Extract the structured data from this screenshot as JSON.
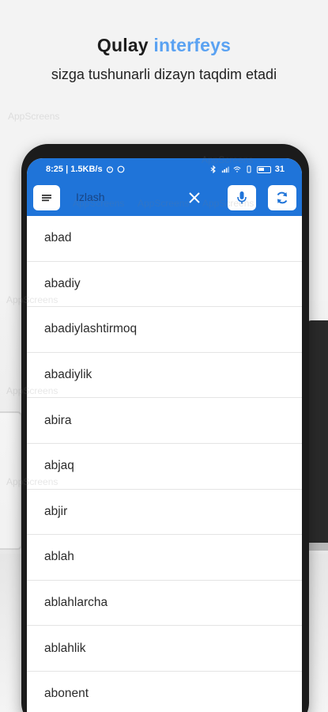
{
  "promo": {
    "title_part1": "Qulay",
    "title_part2": "interfeys",
    "subtitle": "sizga tushunarli dizayn taqdim etadi"
  },
  "status_bar": {
    "time_speed": "8:25 | 1.5KB/s",
    "battery": "31"
  },
  "toolbar": {
    "search_placeholder": "Izlash",
    "menu_icon": "menu-icon",
    "clear_icon": "close-icon",
    "mic_icon": "microphone-icon",
    "sync_icon": "sync-icon"
  },
  "colors": {
    "app_bar": "#1f74d9",
    "accent": "#5aa2f2"
  },
  "words": [
    "abad",
    "abadiy",
    "abadiylashtirmoq",
    "abadiylik",
    "abira",
    "abjaq",
    "abjir",
    "ablah",
    "ablahlarcha",
    "ablahlik",
    "abonent"
  ],
  "watermark_text": "AppScreens"
}
